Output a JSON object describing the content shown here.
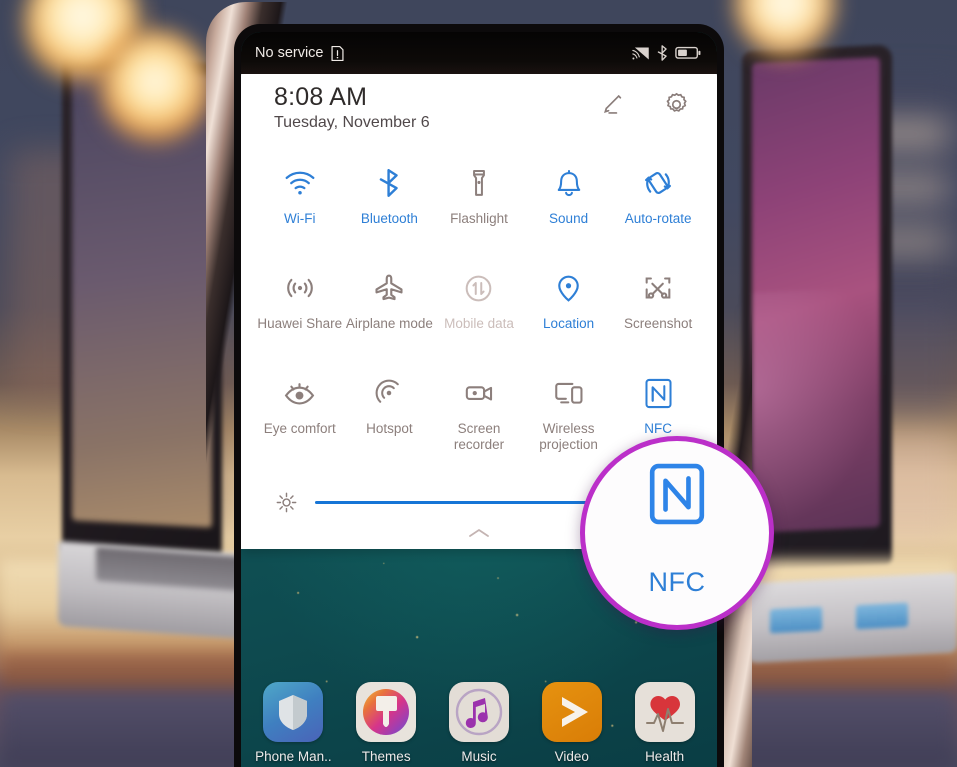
{
  "device": {
    "status_bar": {
      "carrier_text": "No service",
      "sim_alert_icon": "sim-alert-icon",
      "cast_icon": "screen-cast-icon",
      "bluetooth_icon": "bluetooth-icon",
      "battery_icon": "battery-half-icon"
    }
  },
  "quick_settings": {
    "time": "8:08 AM",
    "date": "Tuesday, November 6",
    "edit_icon": "pencil-edit-icon",
    "settings_icon": "gear-icon",
    "collapse_icon": "chevron-up-icon",
    "brightness": {
      "icon": "brightness-sun-icon",
      "value_percent": 82
    },
    "tiles": [
      {
        "label": "Wi-Fi",
        "icon": "wifi-icon",
        "state": "on"
      },
      {
        "label": "Bluetooth",
        "icon": "bluetooth-icon",
        "state": "on"
      },
      {
        "label": "Flashlight",
        "icon": "flashlight-icon",
        "state": "off"
      },
      {
        "label": "Sound",
        "icon": "bell-sound-icon",
        "state": "on"
      },
      {
        "label": "Auto-rotate",
        "icon": "auto-rotate-icon",
        "state": "on"
      },
      {
        "label": "Huawei Share",
        "icon": "huawei-share-icon",
        "state": "off"
      },
      {
        "label": "Airplane mode",
        "icon": "airplane-icon",
        "state": "off"
      },
      {
        "label": "Mobile data",
        "icon": "mobile-data-icon",
        "state": "dim"
      },
      {
        "label": "Location",
        "icon": "location-pin-icon",
        "state": "on"
      },
      {
        "label": "Screenshot",
        "icon": "screenshot-icon",
        "state": "off"
      },
      {
        "label": "Eye comfort",
        "icon": "eye-comfort-icon",
        "state": "off"
      },
      {
        "label": "Hotspot",
        "icon": "hotspot-icon",
        "state": "off"
      },
      {
        "label": "Screen recorder",
        "icon": "screen-recorder-icon",
        "state": "off"
      },
      {
        "label": "Wireless projection",
        "icon": "wireless-projection-icon",
        "state": "off"
      },
      {
        "label": "NFC",
        "icon": "nfc-icon",
        "state": "on"
      }
    ]
  },
  "callout": {
    "label": "NFC",
    "icon": "nfc-icon",
    "border_color": "#bb2fc9"
  },
  "home_screen": {
    "dock": [
      {
        "label": "Phone Man..",
        "icon": "shield-icon"
      },
      {
        "label": "Themes",
        "icon": "paintbrush-icon"
      },
      {
        "label": "Music",
        "icon": "music-note-icon"
      },
      {
        "label": "Video",
        "icon": "play-triangle-icon"
      },
      {
        "label": "Health",
        "icon": "heart-pulse-icon"
      }
    ]
  },
  "colors": {
    "active_blue": "#2e7fd6",
    "inactive_gray": "#8c7f7c",
    "disabled_gray": "#cbbdba",
    "slider_blue": "#1675d6",
    "callout_magenta": "#bb2fc9"
  }
}
